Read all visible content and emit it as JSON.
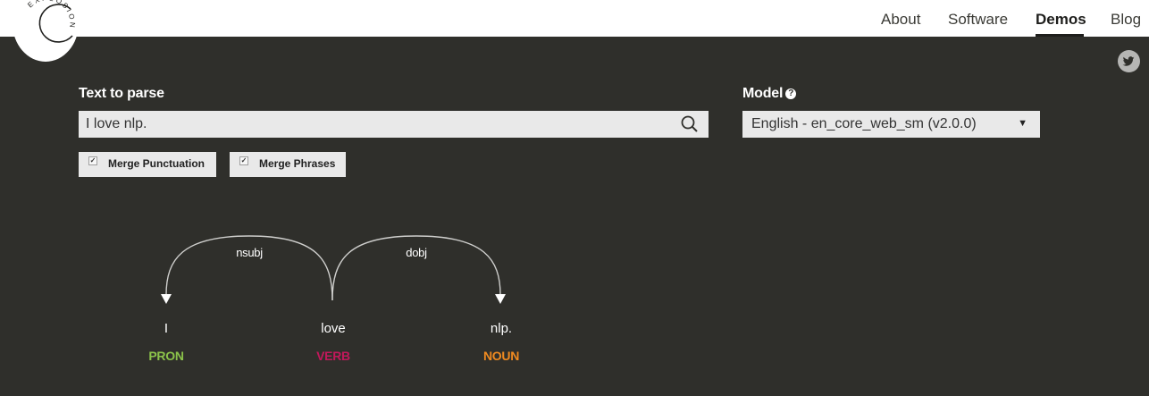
{
  "header": {
    "logo_text": "EXPLOSION",
    "nav": [
      {
        "label": "About"
      },
      {
        "label": "Software"
      },
      {
        "label": "Demos",
        "active": true
      },
      {
        "label": "Blog"
      }
    ]
  },
  "form": {
    "text_label": "Text to parse",
    "text_value": "I love nlp.",
    "model_label": "Model",
    "model_value": "English - en_core_web_sm (v2.0.0)",
    "options": [
      {
        "label": "Merge Punctuation",
        "checked": true
      },
      {
        "label": "Merge Phrases",
        "checked": true
      }
    ]
  },
  "parse": {
    "words": [
      {
        "text": "I",
        "tag": "PRON"
      },
      {
        "text": "love",
        "tag": "VERB"
      },
      {
        "text": "nlp.",
        "tag": "NOUN"
      }
    ],
    "arcs": [
      {
        "label": "nsubj",
        "head": 1,
        "dependent": 0
      },
      {
        "label": "dobj",
        "head": 1,
        "dependent": 2
      }
    ]
  },
  "colors": {
    "background": "#2f2f2b",
    "PRON": "#8bc34a",
    "VERB": "#c2185b",
    "NOUN": "#ef8a20"
  },
  "icons": [
    "logo-icon",
    "search-icon",
    "twitter-icon",
    "help-icon",
    "dropdown-caret-icon"
  ]
}
